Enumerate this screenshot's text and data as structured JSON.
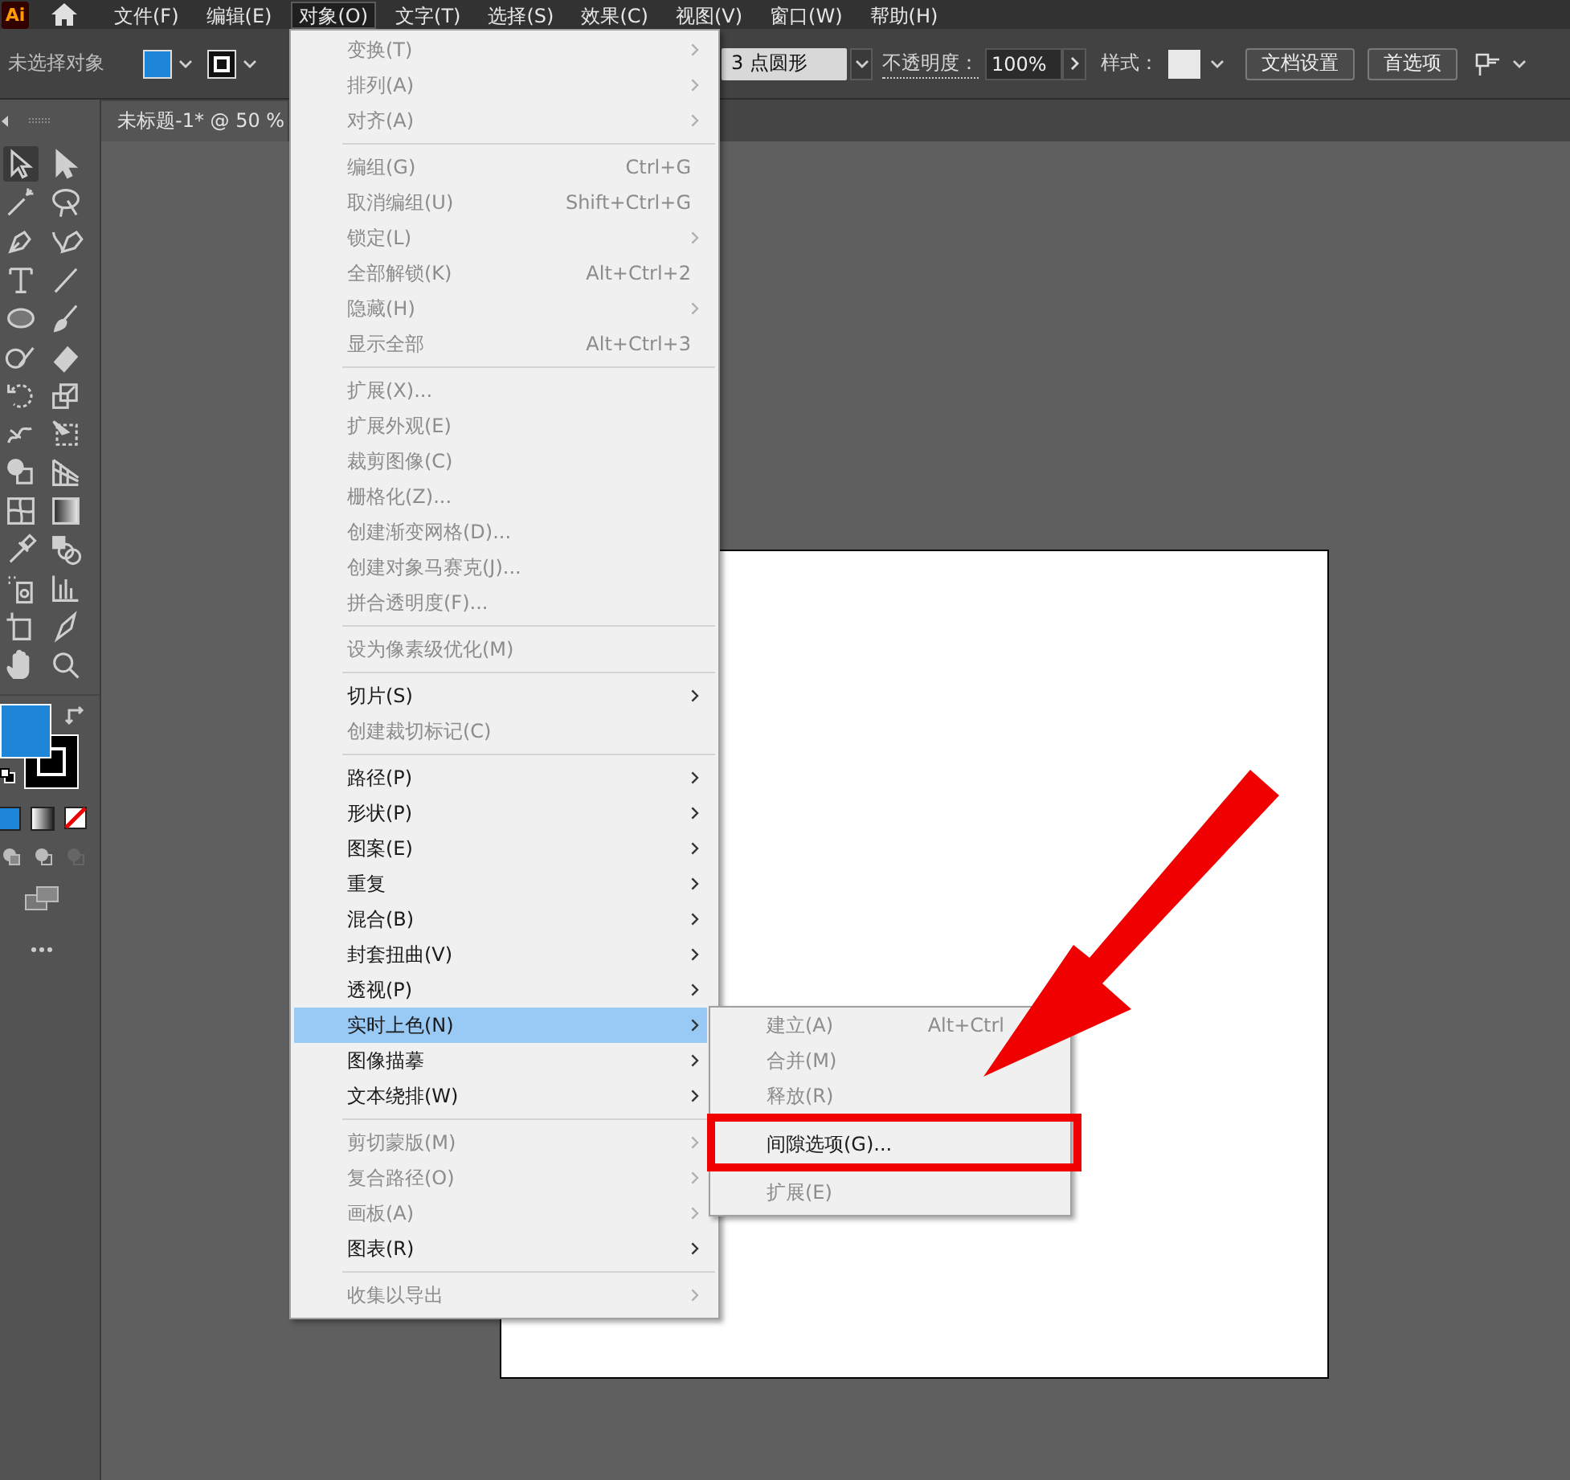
{
  "app_logo": "Ai",
  "menubar": [
    {
      "label": "文件(F)",
      "selected": false
    },
    {
      "label": "编辑(E)",
      "selected": false
    },
    {
      "label": "对象(O)",
      "selected": true
    },
    {
      "label": "文字(T)",
      "selected": false
    },
    {
      "label": "选择(S)",
      "selected": false
    },
    {
      "label": "效果(C)",
      "selected": false
    },
    {
      "label": "视图(V)",
      "selected": false
    },
    {
      "label": "窗口(W)",
      "selected": false
    },
    {
      "label": "帮助(H)",
      "selected": false
    }
  ],
  "control_bar": {
    "selection_status": "未选择对象",
    "brush": "3 点圆形",
    "opacity_label": "不透明度：",
    "opacity": "100%",
    "style_label": "样式：",
    "buttons": [
      "文档设置",
      "首选项"
    ]
  },
  "document_tab": {
    "title": "未标题-1* @ 50 %"
  },
  "object_menu": {
    "groups": [
      {
        "items": [
          {
            "label": "变换(T)",
            "disabled": true,
            "has_submenu": true,
            "selected": false
          },
          {
            "label": "排列(A)",
            "disabled": true,
            "has_submenu": true,
            "selected": false
          },
          {
            "label": "对齐(A)",
            "disabled": true,
            "has_submenu": true,
            "selected": false
          }
        ]
      },
      {
        "items": [
          {
            "label": "编组(G)",
            "shortcut": "Ctrl+G",
            "disabled": true,
            "has_submenu": false,
            "selected": false
          },
          {
            "label": "取消编组(U)",
            "shortcut": "Shift+Ctrl+G",
            "disabled": true,
            "has_submenu": false,
            "selected": false
          },
          {
            "label": "锁定(L)",
            "disabled": true,
            "has_submenu": true,
            "selected": false
          },
          {
            "label": "全部解锁(K)",
            "shortcut": "Alt+Ctrl+2",
            "disabled": true,
            "has_submenu": false,
            "selected": false
          },
          {
            "label": "隐藏(H)",
            "disabled": true,
            "has_submenu": true,
            "selected": false
          },
          {
            "label": "显示全部",
            "shortcut": "Alt+Ctrl+3",
            "disabled": true,
            "has_submenu": false,
            "selected": false
          }
        ]
      },
      {
        "items": [
          {
            "label": "扩展(X)...",
            "disabled": true,
            "has_submenu": false,
            "selected": false
          },
          {
            "label": "扩展外观(E)",
            "disabled": true,
            "has_submenu": false,
            "selected": false
          },
          {
            "label": "裁剪图像(C)",
            "disabled": true,
            "has_submenu": false,
            "selected": false
          },
          {
            "label": "栅格化(Z)...",
            "disabled": true,
            "has_submenu": false,
            "selected": false
          },
          {
            "label": "创建渐变网格(D)...",
            "disabled": true,
            "has_submenu": false,
            "selected": false
          },
          {
            "label": "创建对象马赛克(J)...",
            "disabled": true,
            "has_submenu": false,
            "selected": false
          },
          {
            "label": "拼合透明度(F)...",
            "disabled": true,
            "has_submenu": false,
            "selected": false
          }
        ]
      },
      {
        "items": [
          {
            "label": "设为像素级优化(M)",
            "disabled": true,
            "has_submenu": false,
            "selected": false
          }
        ]
      },
      {
        "items": [
          {
            "label": "切片(S)",
            "disabled": false,
            "has_submenu": true,
            "selected": false
          },
          {
            "label": "创建裁切标记(C)",
            "disabled": true,
            "has_submenu": false,
            "selected": false
          }
        ]
      },
      {
        "items": [
          {
            "label": "路径(P)",
            "disabled": false,
            "has_submenu": true,
            "selected": false
          },
          {
            "label": "形状(P)",
            "disabled": false,
            "has_submenu": true,
            "selected": false
          },
          {
            "label": "图案(E)",
            "disabled": false,
            "has_submenu": true,
            "selected": false
          },
          {
            "label": "重复",
            "disabled": false,
            "has_submenu": true,
            "selected": false
          },
          {
            "label": "混合(B)",
            "disabled": false,
            "has_submenu": true,
            "selected": false
          },
          {
            "label": "封套扭曲(V)",
            "disabled": false,
            "has_submenu": true,
            "selected": false
          },
          {
            "label": "透视(P)",
            "disabled": false,
            "has_submenu": true,
            "selected": false
          },
          {
            "label": "实时上色(N)",
            "disabled": false,
            "has_submenu": true,
            "selected": true
          },
          {
            "label": "图像描摹",
            "disabled": false,
            "has_submenu": true,
            "selected": false
          },
          {
            "label": "文本绕排(W)",
            "disabled": false,
            "has_submenu": true,
            "selected": false
          }
        ]
      },
      {
        "items": [
          {
            "label": "剪切蒙版(M)",
            "disabled": true,
            "has_submenu": true,
            "selected": false
          },
          {
            "label": "复合路径(O)",
            "disabled": true,
            "has_submenu": true,
            "selected": false
          },
          {
            "label": "画板(A)",
            "disabled": true,
            "has_submenu": true,
            "selected": false
          },
          {
            "label": "图表(R)",
            "disabled": false,
            "has_submenu": true,
            "selected": false
          }
        ]
      },
      {
        "items": [
          {
            "label": "收集以导出",
            "disabled": true,
            "has_submenu": true,
            "selected": false
          }
        ]
      }
    ]
  },
  "live_paint_submenu": {
    "groups": [
      {
        "items": [
          {
            "label": "建立(A)",
            "shortcut": "Alt+Ctrl",
            "disabled": true,
            "highlighted": false
          },
          {
            "label": "合并(M)",
            "disabled": true,
            "highlighted": false
          },
          {
            "label": "释放(R)",
            "disabled": true,
            "highlighted": false
          }
        ]
      },
      {
        "items": [
          {
            "label": "间隙选项(G)...",
            "disabled": false,
            "highlighted": true
          }
        ]
      },
      {
        "items": [
          {
            "label": "扩展(E)",
            "disabled": true,
            "highlighted": false
          }
        ]
      }
    ]
  },
  "pointer_arrow": true
}
